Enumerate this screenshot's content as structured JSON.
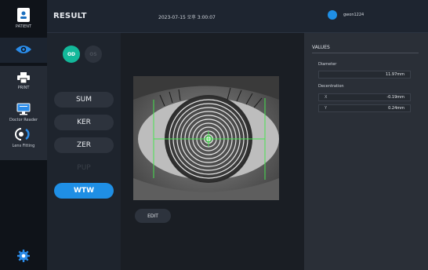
{
  "sidebar": {
    "items": [
      {
        "label": "PATIENT"
      },
      {
        "label": ""
      },
      {
        "label": "PRINT"
      },
      {
        "label": "Doctor Reader"
      },
      {
        "label": "Lens Fitting"
      },
      {
        "label": ""
      }
    ]
  },
  "header": {
    "title": "RESULT",
    "datetime": "2023-07-15 오후 3:00:07",
    "user": "gwon1224"
  },
  "controls": {
    "eye_od": "OD",
    "eye_os": "OS",
    "modes": [
      "SUM",
      "KER",
      "ZER",
      "PUP",
      "WTW"
    ]
  },
  "center": {
    "edit_label": "EDIT"
  },
  "values": {
    "title": "VALUES",
    "diameter_label": "Diameter",
    "diameter_value": "11.97mm",
    "decentration_label": "Decentration",
    "dec_x_axis": "X",
    "dec_x_value": "-0.19mm",
    "dec_y_axis": "Y",
    "dec_y_value": "0.24mm"
  },
  "colors": {
    "accent": "#1f8fe5",
    "od_active": "#13b89a",
    "overlay": "#46e24f"
  },
  "icons": [
    "patient-icon",
    "eye-icon",
    "printer-icon",
    "monitor-icon",
    "lens-icon",
    "settings-icon"
  ]
}
